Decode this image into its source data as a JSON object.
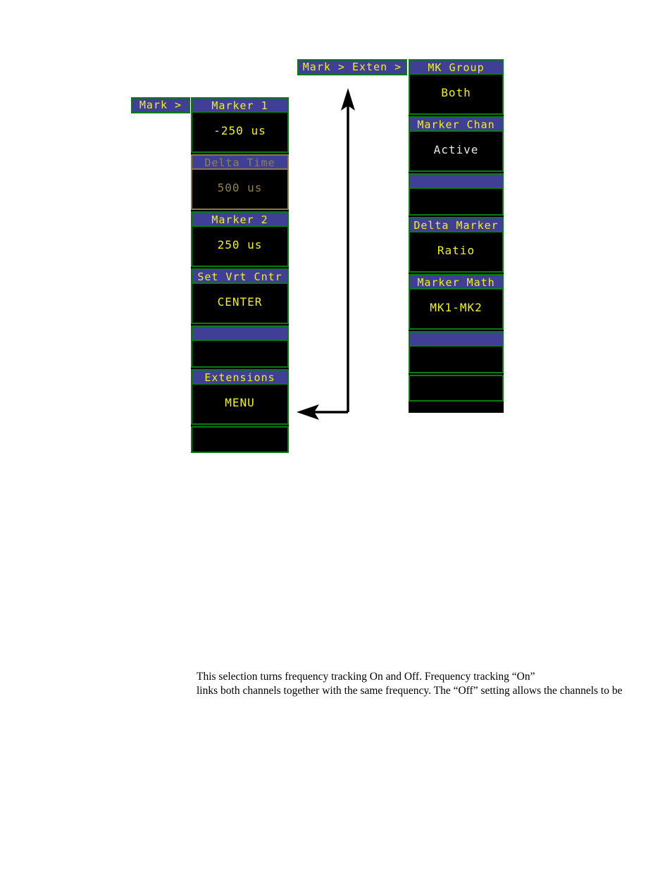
{
  "tabs": {
    "mark": "Mark >",
    "breadcrumb": "Mark > Exten >"
  },
  "colors": {
    "header_bg": "#3f3f96",
    "border_green": "#0a7a12",
    "border_dim": "#8a7b42",
    "text_yellow": "#f2f20d",
    "text_dim": "#8d8446",
    "text_white": "#e6e6e6",
    "panel_bg": "#000000"
  },
  "left_panel": {
    "name": "Mark",
    "cells": [
      {
        "head": "Marker 1",
        "value": "-250 us",
        "state": "active",
        "value_color": "yellow"
      },
      {
        "head": "Delta Time",
        "value": "500 us",
        "state": "dimmed",
        "value_color": "dim"
      },
      {
        "head": "Marker 2",
        "value": "250 us",
        "state": "active",
        "value_color": "yellow"
      },
      {
        "head": "Set Vrt Cntr",
        "value": "CENTER",
        "state": "active",
        "value_color": "yellow"
      },
      {
        "head": "",
        "value": "",
        "state": "active",
        "value_color": "yellow"
      },
      {
        "head": "Extensions",
        "value": "MENU",
        "state": "active",
        "value_color": "yellow"
      },
      {
        "head": null,
        "value": "",
        "state": "active",
        "value_color": "yellow"
      }
    ]
  },
  "right_panel": {
    "name": "Mark > Exten",
    "cells": [
      {
        "head": "MK Group",
        "value": "Both",
        "state": "active",
        "value_color": "yellow"
      },
      {
        "head": "Marker Chan",
        "value": "Active",
        "state": "active",
        "value_color": "white"
      },
      {
        "head": "",
        "value": "",
        "state": "active",
        "value_color": "yellow"
      },
      {
        "head": "Delta Marker",
        "value": "Ratio",
        "state": "active",
        "value_color": "yellow"
      },
      {
        "head": "Marker Math",
        "value": "MK1-MK2",
        "state": "active",
        "value_color": "yellow"
      },
      {
        "head": "",
        "value": "",
        "state": "active",
        "value_color": "yellow"
      },
      {
        "head": null,
        "value": "",
        "state": "active",
        "value_color": "yellow"
      }
    ]
  },
  "connector": {
    "up_arrow_name": "arrow-up-to-breadcrumb",
    "left_arrow_name": "arrow-left-to-extensions-menu"
  },
  "body_copy": {
    "line1": "This selection turns frequency tracking On and Off. Frequency tracking “On”",
    "line2": "links both channels together with the same frequency. The “Off” setting allows the channels to be"
  }
}
